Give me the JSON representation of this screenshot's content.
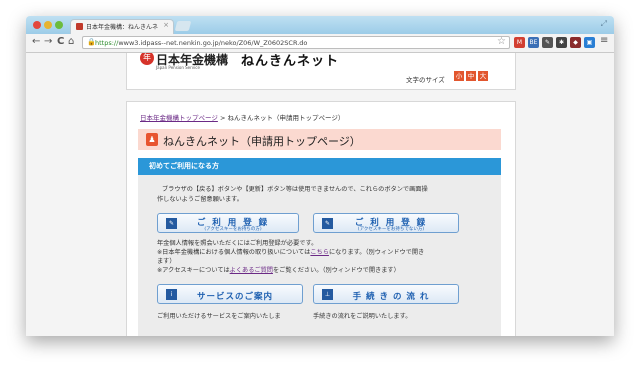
{
  "browser": {
    "tab_title": "日本年金機構：ねんきんネ",
    "url_secure": "https://",
    "url_rest": "www3.idpass--net.nenkin.go.jp/neko/Z06/W_Z0602SCR.do",
    "close_glyph": "×",
    "back_glyph": "←",
    "forward_glyph": "→",
    "reload_glyph": "C",
    "home_glyph": "⌂",
    "star_glyph": "☆",
    "menu_glyph": "≡",
    "resize_glyph": "⤢",
    "extensions": [
      {
        "name": "gmail-icon",
        "label": "M",
        "color": "#d23f31"
      },
      {
        "name": "extension-icon-2",
        "label": "BE",
        "color": "#3b6fb6"
      },
      {
        "name": "extension-icon-3",
        "label": "✎",
        "color": "#555555"
      },
      {
        "name": "extension-icon-4",
        "label": "✱",
        "color": "#444444"
      },
      {
        "name": "extension-icon-5",
        "label": "◆",
        "color": "#8a2a2a"
      },
      {
        "name": "extension-icon-6",
        "label": "▣",
        "color": "#2a7fd4"
      }
    ]
  },
  "header": {
    "logo_mark": "年",
    "logo_text": "日本年金機構",
    "logo_sub": "Japan Pension Service",
    "site_name": "ねんきんネット",
    "font_size_label": "文字のサイズ",
    "font_sizes": [
      "小",
      "中",
      "大"
    ]
  },
  "breadcrumb": {
    "home_link": "日本年金機構トップページ",
    "separator": ">",
    "current": "ねんきんネット（申請用トップページ）"
  },
  "page": {
    "title_icon": "♟",
    "title": "ねんきんネット（申請用トップページ）",
    "section_title": "初めてご利用になる方"
  },
  "notes": {
    "browser_warning_1": "ブラウザの【戻る】ボタンや【更新】ボタン等は使用できませんので、これらのボタンで画面操",
    "browser_warning_2": "作しないようご留意願います。",
    "info_1": "年金個人情報を照会いただくにはご利用登録が必要です。",
    "info_2a": "※日本年金機構における個人情報の取り扱いについては",
    "info_2_link": "こちら",
    "info_2b": "になります。（別ウィンドウで開き",
    "info_3": "ます）",
    "info_4a": "※アクセスキーについては",
    "info_4_link": "よくあるご質問",
    "info_4b": "をご覧ください。（別ウィンドウで開きます）"
  },
  "buttons": {
    "register_with_key": {
      "label": "ご 利 用 登 録",
      "sub": "(アクセスキーをお持ちの方)"
    },
    "register_without_key": {
      "label": "ご 利 用 登 録",
      "sub": "(アクセスキーをお持ちでない方)"
    },
    "service_info": {
      "label": "サービスのご案内",
      "icon": "i"
    },
    "procedure_flow": {
      "label": "手 続 き の 流 れ",
      "icon": "⊥"
    }
  },
  "descriptions": {
    "service_info": "ご利用いただけるサービスをご案内いたしま",
    "procedure_flow": "手続きの流れをご説明いたします。"
  }
}
